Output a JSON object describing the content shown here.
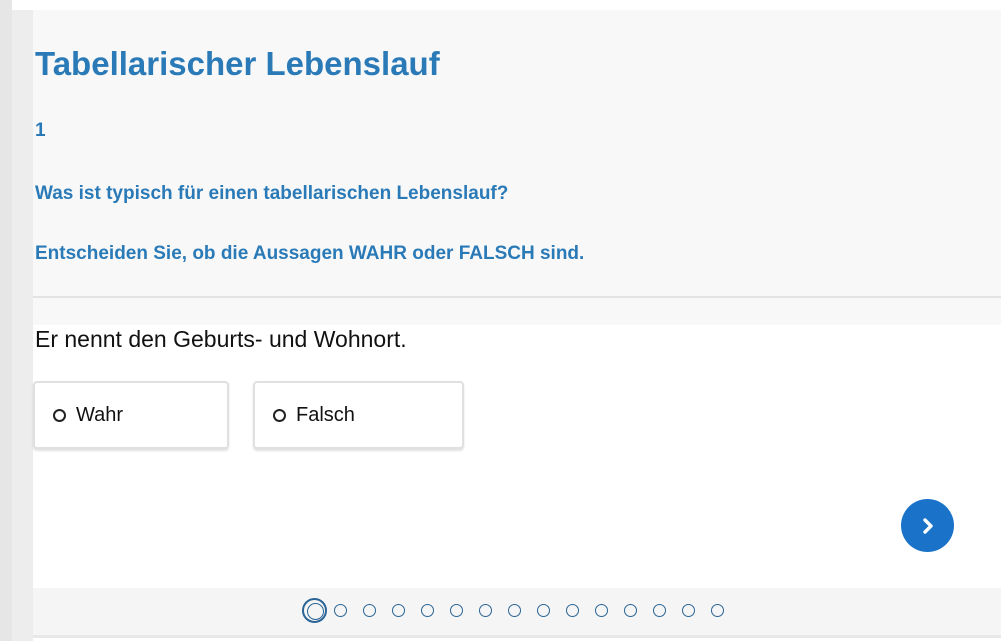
{
  "header": {
    "title": "Tabellarischer Lebenslauf",
    "task_number": "1",
    "question": "Was ist typisch für einen tabellarischen Lebenslauf?",
    "instruction": "Entscheiden Sie, ob die Aussagen WAHR oder FALSCH sind."
  },
  "statement": {
    "text": "Er nennt den Geburts- und Wohnort."
  },
  "options": {
    "true_label": "Wahr",
    "false_label": "Falsch"
  },
  "navigation": {
    "next_icon": "chevron-right-icon"
  },
  "pager": {
    "total": 15,
    "current": 1
  },
  "colors": {
    "accent": "#2a7ab8",
    "button": "#1a73c9",
    "pager": "#2a6496"
  }
}
